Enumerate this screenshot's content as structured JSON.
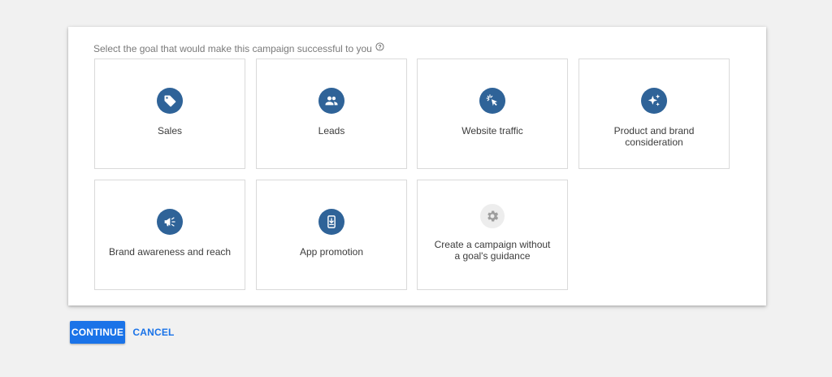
{
  "prompt": {
    "text": "Select the goal that would make this campaign successful to you",
    "help_icon": "help-circle-icon"
  },
  "goals": [
    {
      "label": "Sales",
      "icon": "tag-icon"
    },
    {
      "label": "Leads",
      "icon": "people-icon"
    },
    {
      "label": "Website traffic",
      "icon": "cursor-click-icon"
    },
    {
      "label": "Product and brand consideration",
      "icon": "sparkle-icon"
    },
    {
      "label": "Brand awareness and reach",
      "icon": "megaphone-icon"
    },
    {
      "label": "App promotion",
      "icon": "mobile-download-icon"
    },
    {
      "label": "Create a campaign without a goal's guidance",
      "icon": "gear-icon"
    }
  ],
  "actions": {
    "continue_label": "CONTINUE",
    "cancel_label": "CANCEL"
  },
  "colors": {
    "accent": "#1a73e8",
    "icon_circle": "#2f6398",
    "icon_circle_muted": "#ededed"
  }
}
